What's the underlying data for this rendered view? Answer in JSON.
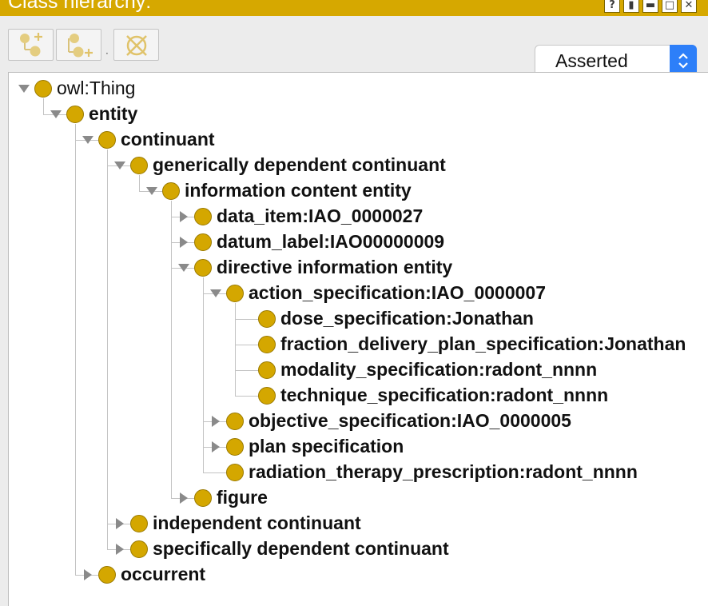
{
  "window": {
    "title": "Class hierarchy:",
    "buttons": [
      {
        "name": "help",
        "glyph": "?"
      },
      {
        "name": "pin",
        "glyph": "▮"
      },
      {
        "name": "minimize",
        "glyph": "▬"
      },
      {
        "name": "maximize",
        "glyph": "□"
      },
      {
        "name": "close",
        "glyph": "✕"
      }
    ]
  },
  "toolbar": {
    "buttons": [
      {
        "icon": "add-subclass-icon"
      },
      {
        "icon": "add-sibling-icon"
      },
      {
        "icon": "delete-class-icon"
      }
    ],
    "separator": "·",
    "view_select": {
      "value": "Asserted"
    }
  },
  "colors": {
    "title_bar": "#d6a800",
    "class_dot": "#d4a700",
    "select_arrow": "#2d7ff9"
  },
  "tree": [
    {
      "label": "owl:Thing",
      "depth": 0,
      "state": "expanded",
      "bold": false
    },
    {
      "label": "entity",
      "depth": 1,
      "state": "expanded",
      "bold": true
    },
    {
      "label": "continuant",
      "depth": 2,
      "state": "expanded",
      "bold": true
    },
    {
      "label": "generically dependent continuant",
      "depth": 3,
      "state": "expanded",
      "bold": true
    },
    {
      "label": "information content entity",
      "depth": 4,
      "state": "expanded",
      "bold": true
    },
    {
      "label": "data_item:IAO_0000027",
      "depth": 5,
      "state": "collapsed",
      "bold": true
    },
    {
      "label": "datum_label:IAO00000009",
      "depth": 5,
      "state": "collapsed",
      "bold": true
    },
    {
      "label": "directive information entity",
      "depth": 5,
      "state": "expanded",
      "bold": true
    },
    {
      "label": "action_specification:IAO_0000007",
      "depth": 6,
      "state": "expanded",
      "bold": true
    },
    {
      "label": "dose_specification:Jonathan",
      "depth": 7,
      "state": "leaf",
      "bold": true
    },
    {
      "label": "fraction_delivery_plan_specification:Jonathan",
      "depth": 7,
      "state": "leaf",
      "bold": true
    },
    {
      "label": "modality_specification:radont_nnnn",
      "depth": 7,
      "state": "leaf",
      "bold": true
    },
    {
      "label": "technique_specification:radont_nnnn",
      "depth": 7,
      "state": "leaf",
      "bold": true
    },
    {
      "label": "objective_specification:IAO_0000005",
      "depth": 6,
      "state": "collapsed",
      "bold": true
    },
    {
      "label": "plan specification",
      "depth": 6,
      "state": "collapsed",
      "bold": true
    },
    {
      "label": "radiation_therapy_prescription:radont_nnnn",
      "depth": 6,
      "state": "leaf",
      "bold": true
    },
    {
      "label": "figure",
      "depth": 5,
      "state": "collapsed",
      "bold": true
    },
    {
      "label": "independent continuant",
      "depth": 3,
      "state": "collapsed",
      "bold": true
    },
    {
      "label": "specifically dependent continuant",
      "depth": 3,
      "state": "collapsed",
      "bold": true
    },
    {
      "label": "occurrent",
      "depth": 2,
      "state": "collapsed",
      "bold": true
    }
  ]
}
